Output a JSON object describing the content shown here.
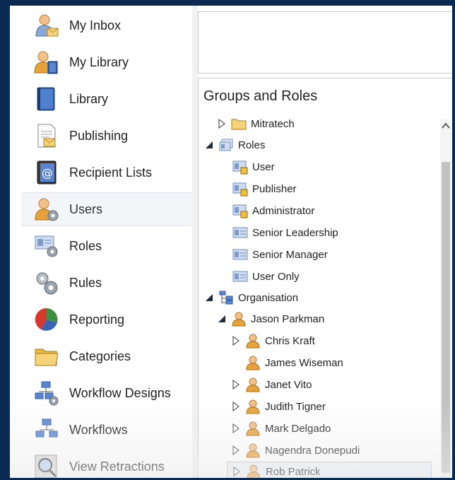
{
  "nav": {
    "items": [
      {
        "label": "My Inbox"
      },
      {
        "label": "My Library"
      },
      {
        "label": "Library"
      },
      {
        "label": "Publishing"
      },
      {
        "label": "Recipient Lists"
      },
      {
        "label": "Users"
      },
      {
        "label": "Roles"
      },
      {
        "label": "Rules"
      },
      {
        "label": "Reporting"
      },
      {
        "label": "Categories"
      },
      {
        "label": "Workflow Designs"
      },
      {
        "label": "Workflows"
      },
      {
        "label": "View Retractions"
      }
    ],
    "active": "Users"
  },
  "groups_panel": {
    "title": "Groups and Roles",
    "tree": [
      {
        "label": "Mitratech",
        "expander": "collapsed",
        "icon": "folder-icon"
      },
      {
        "label": "Roles",
        "expander": "expanded",
        "icon": "roles-icon"
      },
      {
        "label": "User",
        "expander": "none",
        "icon": "locked-role-icon"
      },
      {
        "label": "Publisher",
        "expander": "none",
        "icon": "locked-role-icon"
      },
      {
        "label": "Administrator",
        "expander": "none",
        "icon": "locked-role-icon"
      },
      {
        "label": "Senior Leadership",
        "expander": "none",
        "icon": "role-card-icon"
      },
      {
        "label": "Senior Manager",
        "expander": "none",
        "icon": "role-card-icon"
      },
      {
        "label": "User Only",
        "expander": "none",
        "icon": "role-card-icon"
      },
      {
        "label": "Organisation",
        "expander": "expanded",
        "icon": "org-chart-icon"
      },
      {
        "label": "Jason Parkman",
        "expander": "expanded",
        "icon": "person-icon"
      },
      {
        "label": "Chris Kraft",
        "expander": "collapsed",
        "icon": "person-icon"
      },
      {
        "label": "James Wiseman",
        "expander": "none",
        "icon": "person-icon"
      },
      {
        "label": "Janet Vito",
        "expander": "collapsed",
        "icon": "person-icon"
      },
      {
        "label": "Judith Tigner",
        "expander": "collapsed",
        "icon": "person-icon"
      },
      {
        "label": "Mark Delgado",
        "expander": "collapsed",
        "icon": "person-icon"
      },
      {
        "label": "Nagendra Donepudi",
        "expander": "collapsed",
        "icon": "person-icon"
      },
      {
        "label": "Rob Patrick",
        "expander": "collapsed",
        "icon": "person-icon"
      }
    ],
    "selected": "Rob Patrick"
  },
  "colors": {
    "background": "#0b2a52",
    "selection_border": "#a9c3e5",
    "person_orange": "#e8a23c"
  }
}
